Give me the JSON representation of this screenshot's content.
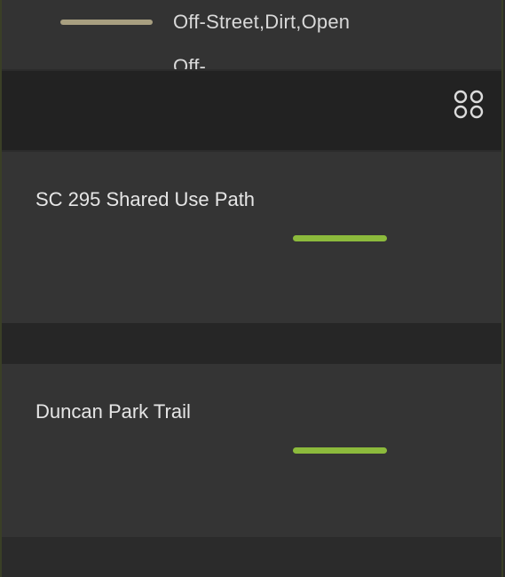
{
  "legend": {
    "items": [
      {
        "label": "Off-Street,Dirt,Open",
        "color": "#a89f80"
      },
      {
        "label": "Off-",
        "color": "#a89f80"
      }
    ]
  },
  "toolbar": {
    "grid_icon": "grid-icon"
  },
  "trails": [
    {
      "name": "SC 295 Shared Use Path",
      "line_color": "#8cba3c"
    },
    {
      "name": "Duncan Park Trail",
      "line_color": "#8cba3c"
    }
  ]
}
